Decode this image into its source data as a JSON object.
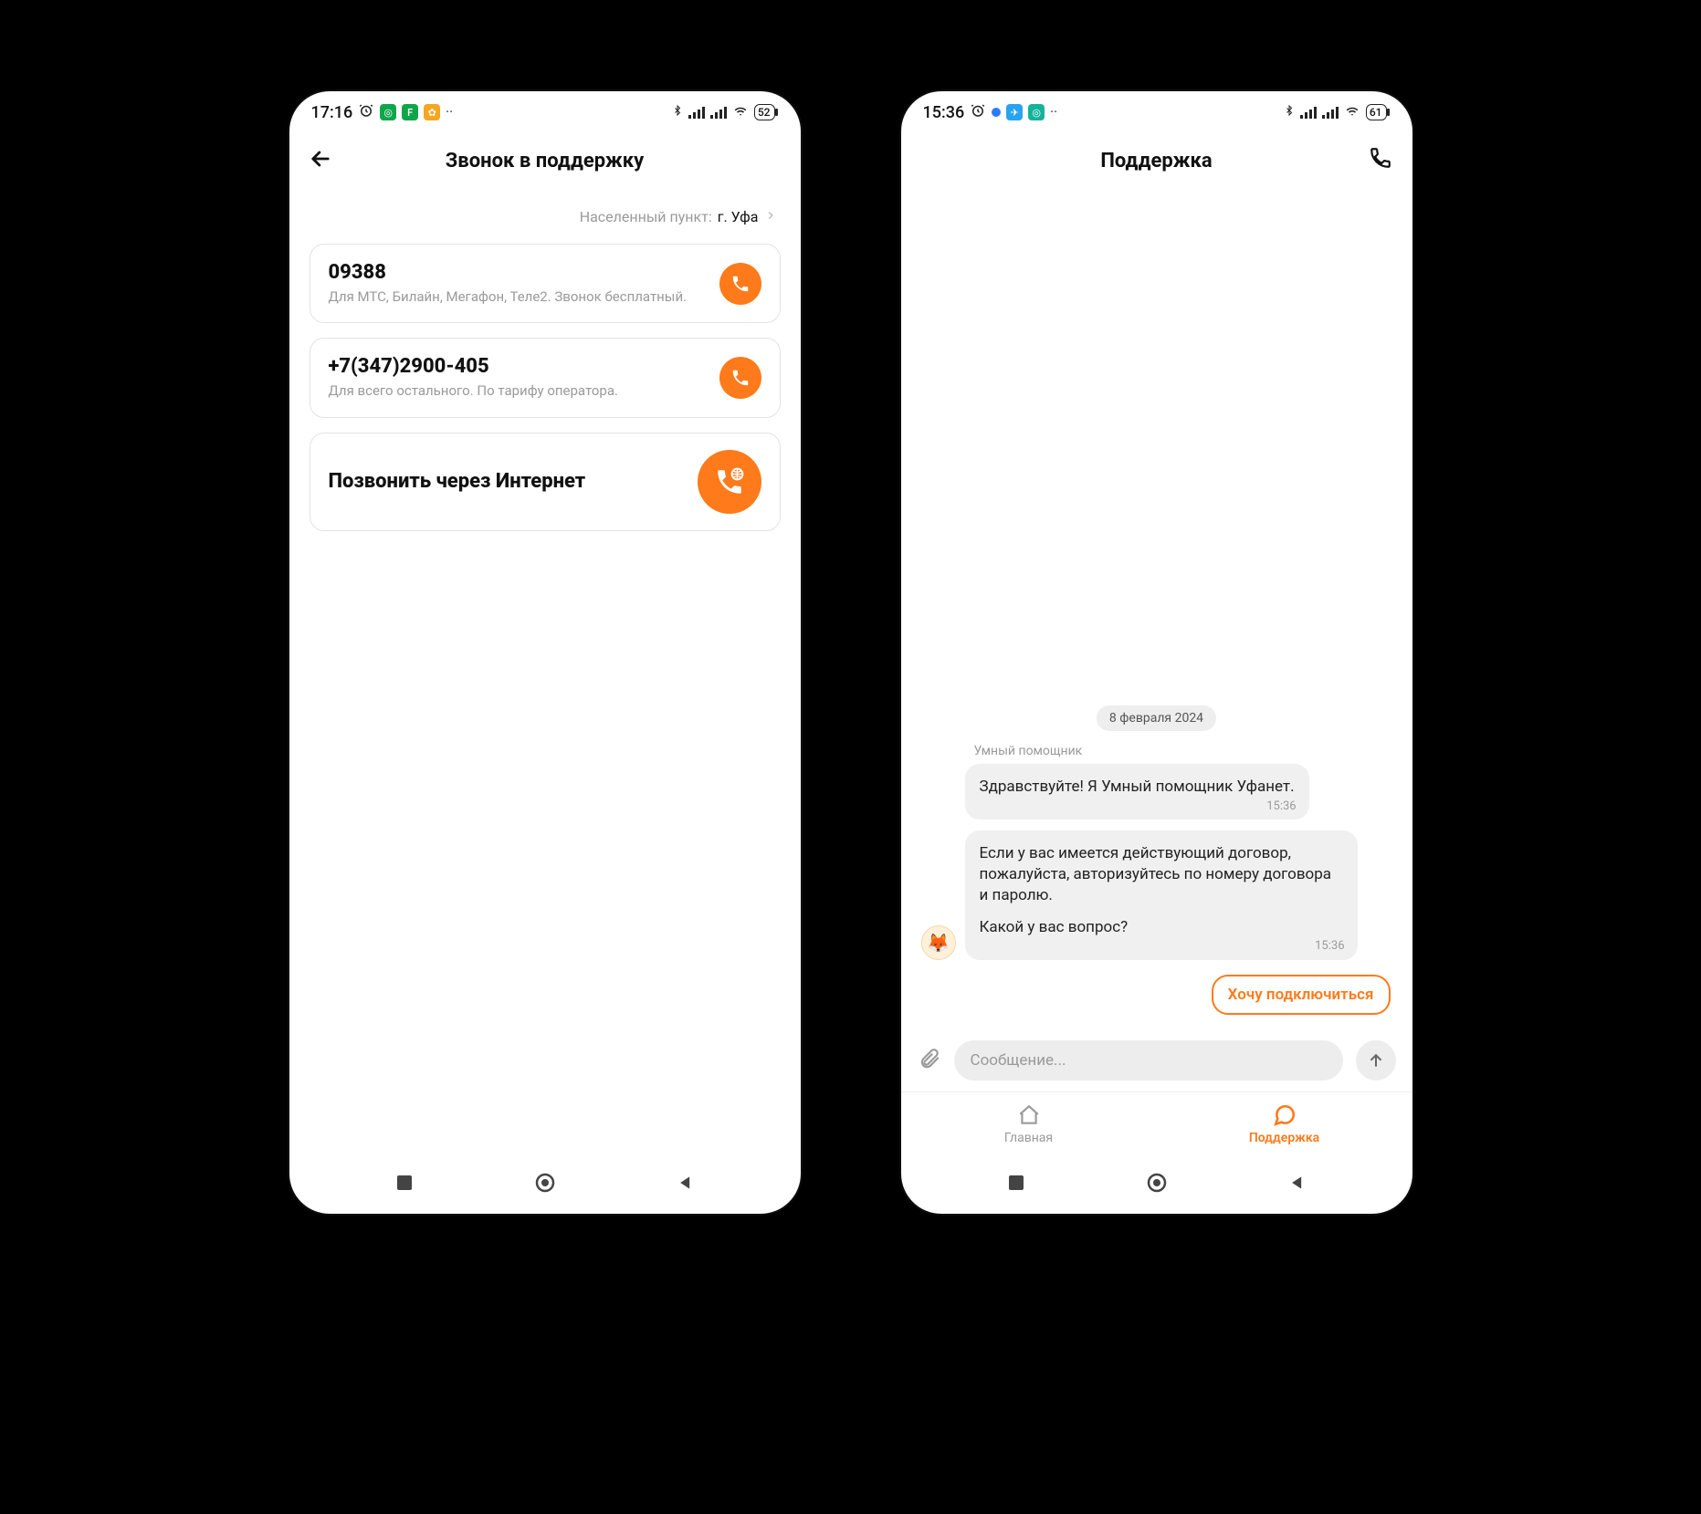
{
  "left": {
    "status": {
      "time": "17:16",
      "battery": "52"
    },
    "header": {
      "title": "Звонок в поддержку"
    },
    "location": {
      "label": "Населенный пункт:",
      "city": "г. Уфа"
    },
    "cards": [
      {
        "title": "09388",
        "sub": "Для МТС, Билайн, Мегафон, Теле2. Звонок бесплатный."
      },
      {
        "title": "+7(347)2900-405",
        "sub": "Для всего остального. По тарифу оператора."
      },
      {
        "title": "Позвонить через Интернет",
        "sub": ""
      }
    ]
  },
  "right": {
    "status": {
      "time": "15:36",
      "battery": "61"
    },
    "header": {
      "title": "Поддержка"
    },
    "chat": {
      "date": "8 февраля 2024",
      "sender": "Умный помощник",
      "messages": [
        {
          "text": "Здравствуйте! Я Умный помощник Уфанет.",
          "time": "15:36"
        },
        {
          "text1": "Если у вас имеется действующий договор, пожалуйста, авторизуйтесь по номеру договора и паролю.",
          "text2": "Какой у вас вопрос?",
          "time": "15:36"
        }
      ],
      "quick_reply": "Хочу подключиться",
      "composer_placeholder": "Сообщение..."
    },
    "tabs": {
      "home": "Главная",
      "support": "Поддержка"
    }
  }
}
